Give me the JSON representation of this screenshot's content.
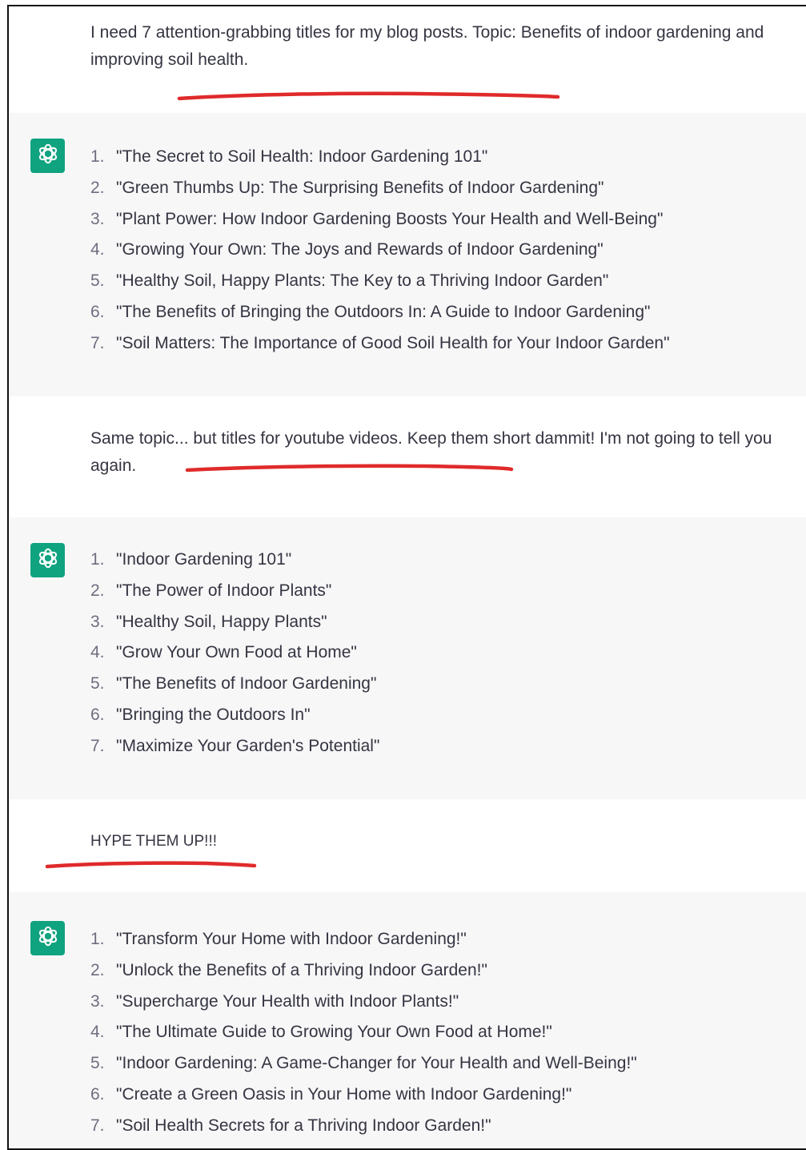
{
  "colors": {
    "brand_green": "#10a37f",
    "scribble_red": "#e02a2a",
    "assistant_bg": "#f7f7f8",
    "user_bg": "#ffffff",
    "text": "#343541"
  },
  "icons": {
    "assistant_avatar": "openai-logo-icon"
  },
  "conversation": {
    "prompt1": "I need 7 attention-grabbing titles for my blog posts. Topic: Benefits of indoor gardening and improving soil health.",
    "answer1": [
      {
        "n": "1.",
        "text": "\"The Secret to Soil Health: Indoor Gardening 101\""
      },
      {
        "n": "2.",
        "text": "\"Green Thumbs Up: The Surprising Benefits of Indoor Gardening\""
      },
      {
        "n": "3.",
        "text": "\"Plant Power: How Indoor Gardening Boosts Your Health and Well-Being\""
      },
      {
        "n": "4.",
        "text": "\"Growing Your Own: The Joys and Rewards of Indoor Gardening\""
      },
      {
        "n": "5.",
        "text": "\"Healthy Soil, Happy Plants: The Key to a Thriving Indoor Garden\""
      },
      {
        "n": "6.",
        "text": "\"The Benefits of Bringing the Outdoors In: A Guide to Indoor Gardening\""
      },
      {
        "n": "7.",
        "text": "\"Soil Matters: The Importance of Good Soil Health for Your Indoor Garden\""
      }
    ],
    "prompt2": "Same topic... but titles for youtube videos. Keep them short dammit! I'm not going to tell you again.",
    "answer2": [
      {
        "n": "1.",
        "text": "\"Indoor Gardening 101\""
      },
      {
        "n": "2.",
        "text": "\"The Power of Indoor Plants\""
      },
      {
        "n": "3.",
        "text": "\"Healthy Soil, Happy Plants\""
      },
      {
        "n": "4.",
        "text": "\"Grow Your Own Food at Home\""
      },
      {
        "n": "5.",
        "text": "\"The Benefits of Indoor Gardening\""
      },
      {
        "n": "6.",
        "text": "\"Bringing the Outdoors In\""
      },
      {
        "n": "7.",
        "text": "\"Maximize Your Garden's Potential\""
      }
    ],
    "prompt3": "HYPE THEM UP!!!",
    "answer3": [
      {
        "n": "1.",
        "text": "\"Transform Your Home with Indoor Gardening!\""
      },
      {
        "n": "2.",
        "text": "\"Unlock the Benefits of a Thriving Indoor Garden!\""
      },
      {
        "n": "3.",
        "text": "\"Supercharge Your Health with Indoor Plants!\""
      },
      {
        "n": "4.",
        "text": "\"The Ultimate Guide to Growing Your Own Food at Home!\""
      },
      {
        "n": "5.",
        "text": "\"Indoor Gardening: A Game-Changer for Your Health and Well-Being!\""
      },
      {
        "n": "6.",
        "text": "\"Create a Green Oasis in Your Home with Indoor Gardening!\""
      },
      {
        "n": "7.",
        "text": "\"Soil Health Secrets for a Thriving Indoor Garden!\""
      }
    ]
  }
}
